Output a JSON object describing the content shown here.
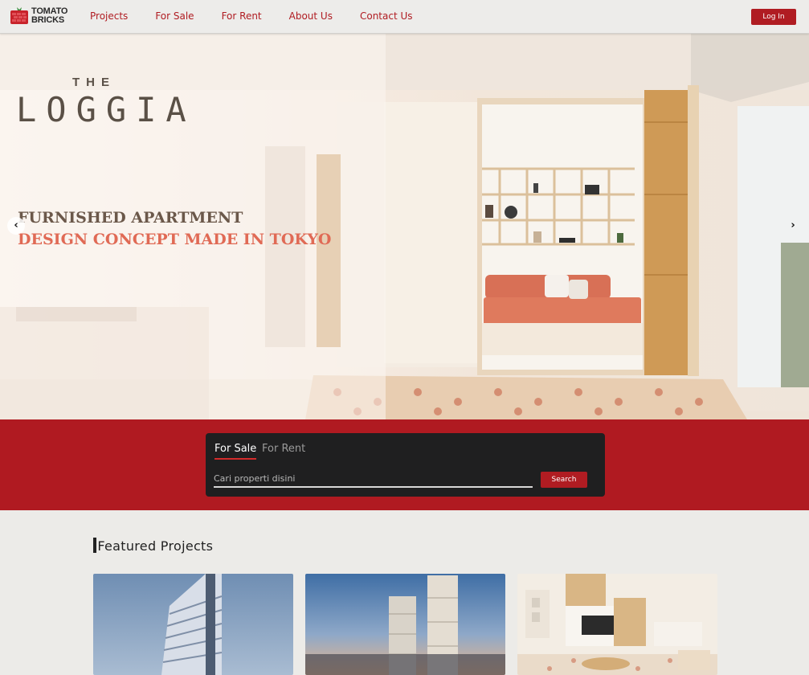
{
  "brand": {
    "logo_line1": "TOMATO",
    "logo_line2": "BRICKS"
  },
  "nav": {
    "items": [
      {
        "label": "Projects"
      },
      {
        "label": "For Sale"
      },
      {
        "label": "For Rent"
      },
      {
        "label": "About Us"
      },
      {
        "label": "Contact Us"
      }
    ],
    "login_label": "Log In"
  },
  "hero": {
    "the": "THE",
    "brand": "LOGGIA",
    "line1": "FURNISHED APARTMENT",
    "line2": "DESIGN CONCEPT MADE IN TOKYO",
    "prev_icon": "chevron-left-icon",
    "next_icon": "chevron-right-icon"
  },
  "search": {
    "tabs": [
      {
        "label": "For Sale",
        "active": true
      },
      {
        "label": "For Rent",
        "active": false
      }
    ],
    "placeholder": "Cari properti disini",
    "button_label": "Search"
  },
  "featured": {
    "title": "Featured Projects"
  },
  "colors": {
    "brand_red": "#b01c22",
    "panel_dark": "#1f1f20",
    "page_bg": "#ecebe8"
  }
}
